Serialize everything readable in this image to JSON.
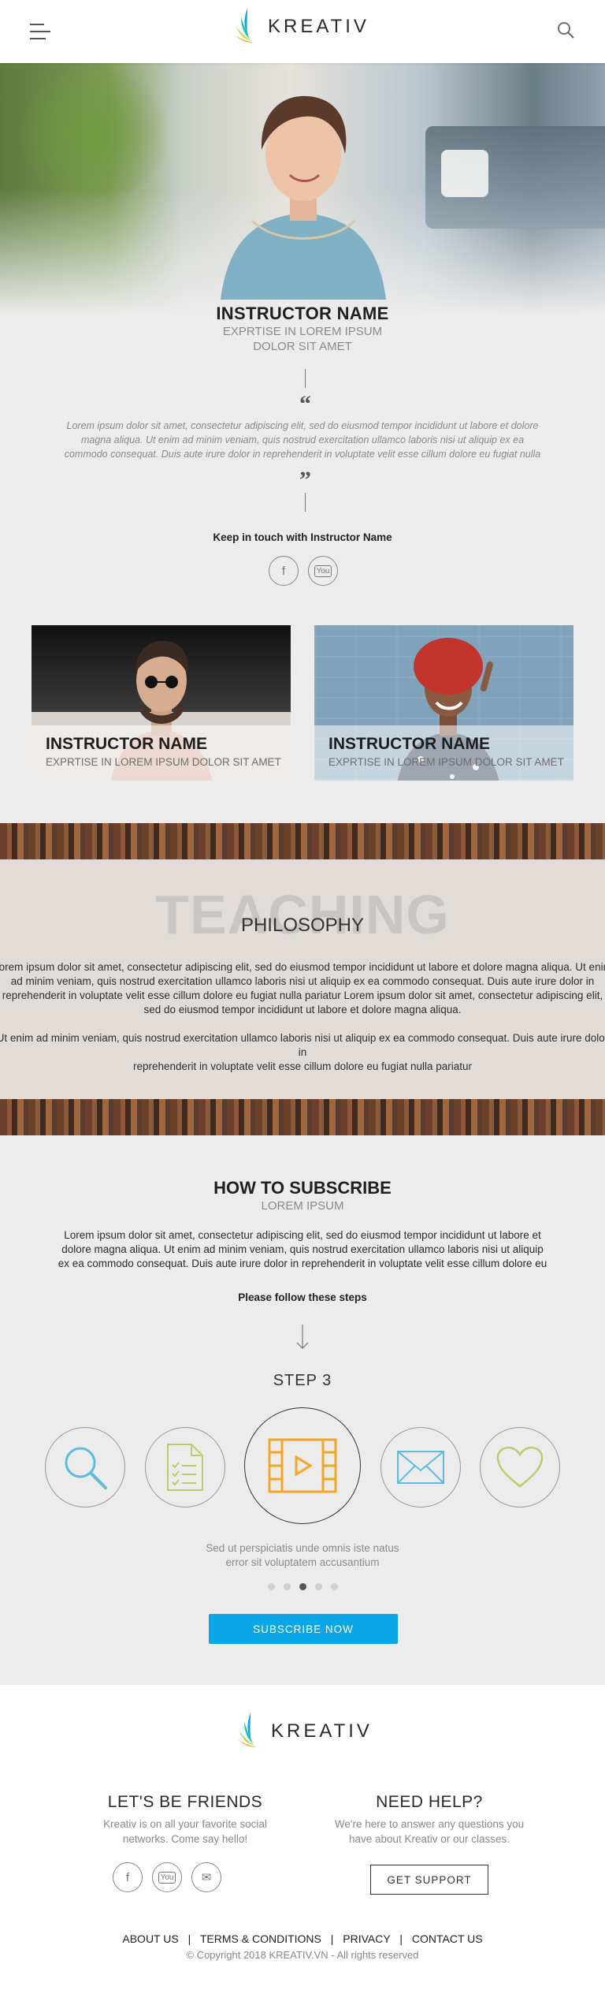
{
  "header": {
    "brand": "KREATIV",
    "menu_icon": "hamburger-icon",
    "search_icon": "search-icon"
  },
  "hero": {
    "name": "INSTRUCTOR NAME",
    "subtitle_line1": "EXPRTISE IN LOREM IPSUM",
    "subtitle_line2": "DOLOR SIT AMET",
    "open_quote": "“",
    "close_quote": "”",
    "quote_line1": "Lorem ipsum dolor sit amet, consectetur adipiscing elit, sed do eiusmod tempor incididunt ut labore et dolore",
    "quote_line2": "magna aliqua. Ut enim ad minim veniam, quis nostrud exercitation ullamco laboris nisi ut aliquip ex ea",
    "quote_line3": "commodo consequat. Duis aute irure dolor in reprehenderit in voluptate velit esse cillum dolore eu fugiat nulla",
    "keep_in_touch": "Keep in touch with Instructor Name",
    "facebook_glyph": "f",
    "youtube_glyph": "You"
  },
  "cards": [
    {
      "name": "INSTRUCTOR NAME",
      "subtitle": "EXPRTISE IN LOREM IPSUM DOLOR SIT AMET"
    },
    {
      "name": "INSTRUCTOR NAME",
      "subtitle": "EXPRTISE IN LOREM IPSUM DOLOR SIT AMET"
    }
  ],
  "philosophy": {
    "watermark": "TEACHING",
    "title": "PHILOSOPHY",
    "p1_line1": "Lorem ipsum dolor sit amet, consectetur adipiscing elit, sed do eiusmod tempor incididunt ut labore et dolore magna aliqua. Ut enim",
    "p1_line2": "ad minim veniam, quis nostrud exercitation ullamco laboris nisi ut aliquip ex ea commodo consequat. Duis aute irure dolor in",
    "p1_line3": "reprehenderit in voluptate velit esse cillum dolore eu fugiat nulla pariatur Lorem ipsum dolor sit amet, consectetur adipiscing elit,",
    "p1_line4": "sed do eiusmod tempor incididunt ut labore et dolore magna aliqua.",
    "p2_line1": "Ut enim ad minim veniam, quis nostrud exercitation ullamco laboris nisi ut aliquip ex ea commodo consequat. Duis aute irure dolor in",
    "p2_line2": "reprehenderit in voluptate velit esse cillum dolore eu fugiat nulla pariatur"
  },
  "subscribe": {
    "title": "HOW TO SUBSCRIBE",
    "subtitle": "LOREM IPSUM",
    "p_line1": "Lorem ipsum dolor sit amet, consectetur adipiscing elit, sed do eiusmod tempor incididunt ut labore et",
    "p_line2": "dolore magna aliqua. Ut enim ad minim veniam, quis nostrud exercitation ullamco laboris nisi ut aliquip",
    "p_line3": "ex ea commodo consequat. Duis aute irure dolor in reprehenderit in voluptate velit esse cillum dolore eu",
    "follow": "Please follow these steps",
    "step_label": "STEP 3",
    "steps": [
      "search-icon",
      "document-checklist-icon",
      "video-icon",
      "envelope-icon",
      "heart-icon"
    ],
    "active_step": 3,
    "caption_line1": "Sed ut perspiciatis unde omnis iste natus",
    "caption_line2": "error sit voluptatem accusantium",
    "button": "SUBSCRIBE NOW",
    "accent": "#0aa7e8",
    "step_active_color": "#f5a623"
  },
  "footer": {
    "brand": "KREATIV",
    "friends_title": "LET'S BE FRIENDS",
    "friends_line1": "Kreativ is on all your favorite social",
    "friends_line2": "networks. Come say hello!",
    "help_title": "NEED HELP?",
    "help_line1": "We're here to answer any questions you",
    "help_line2": "have about Kreativ or our classes.",
    "help_button": "GET SUPPORT",
    "links": [
      "ABOUT US",
      "TERMS & CONDITIONS",
      "PRIVACY",
      "CONTACT US"
    ],
    "separator": "|",
    "copyright": "© Copyright 2018 KREATIV.VN - All rights reserved",
    "facebook_glyph": "f",
    "youtube_glyph": "You",
    "mail_glyph": "✉"
  }
}
